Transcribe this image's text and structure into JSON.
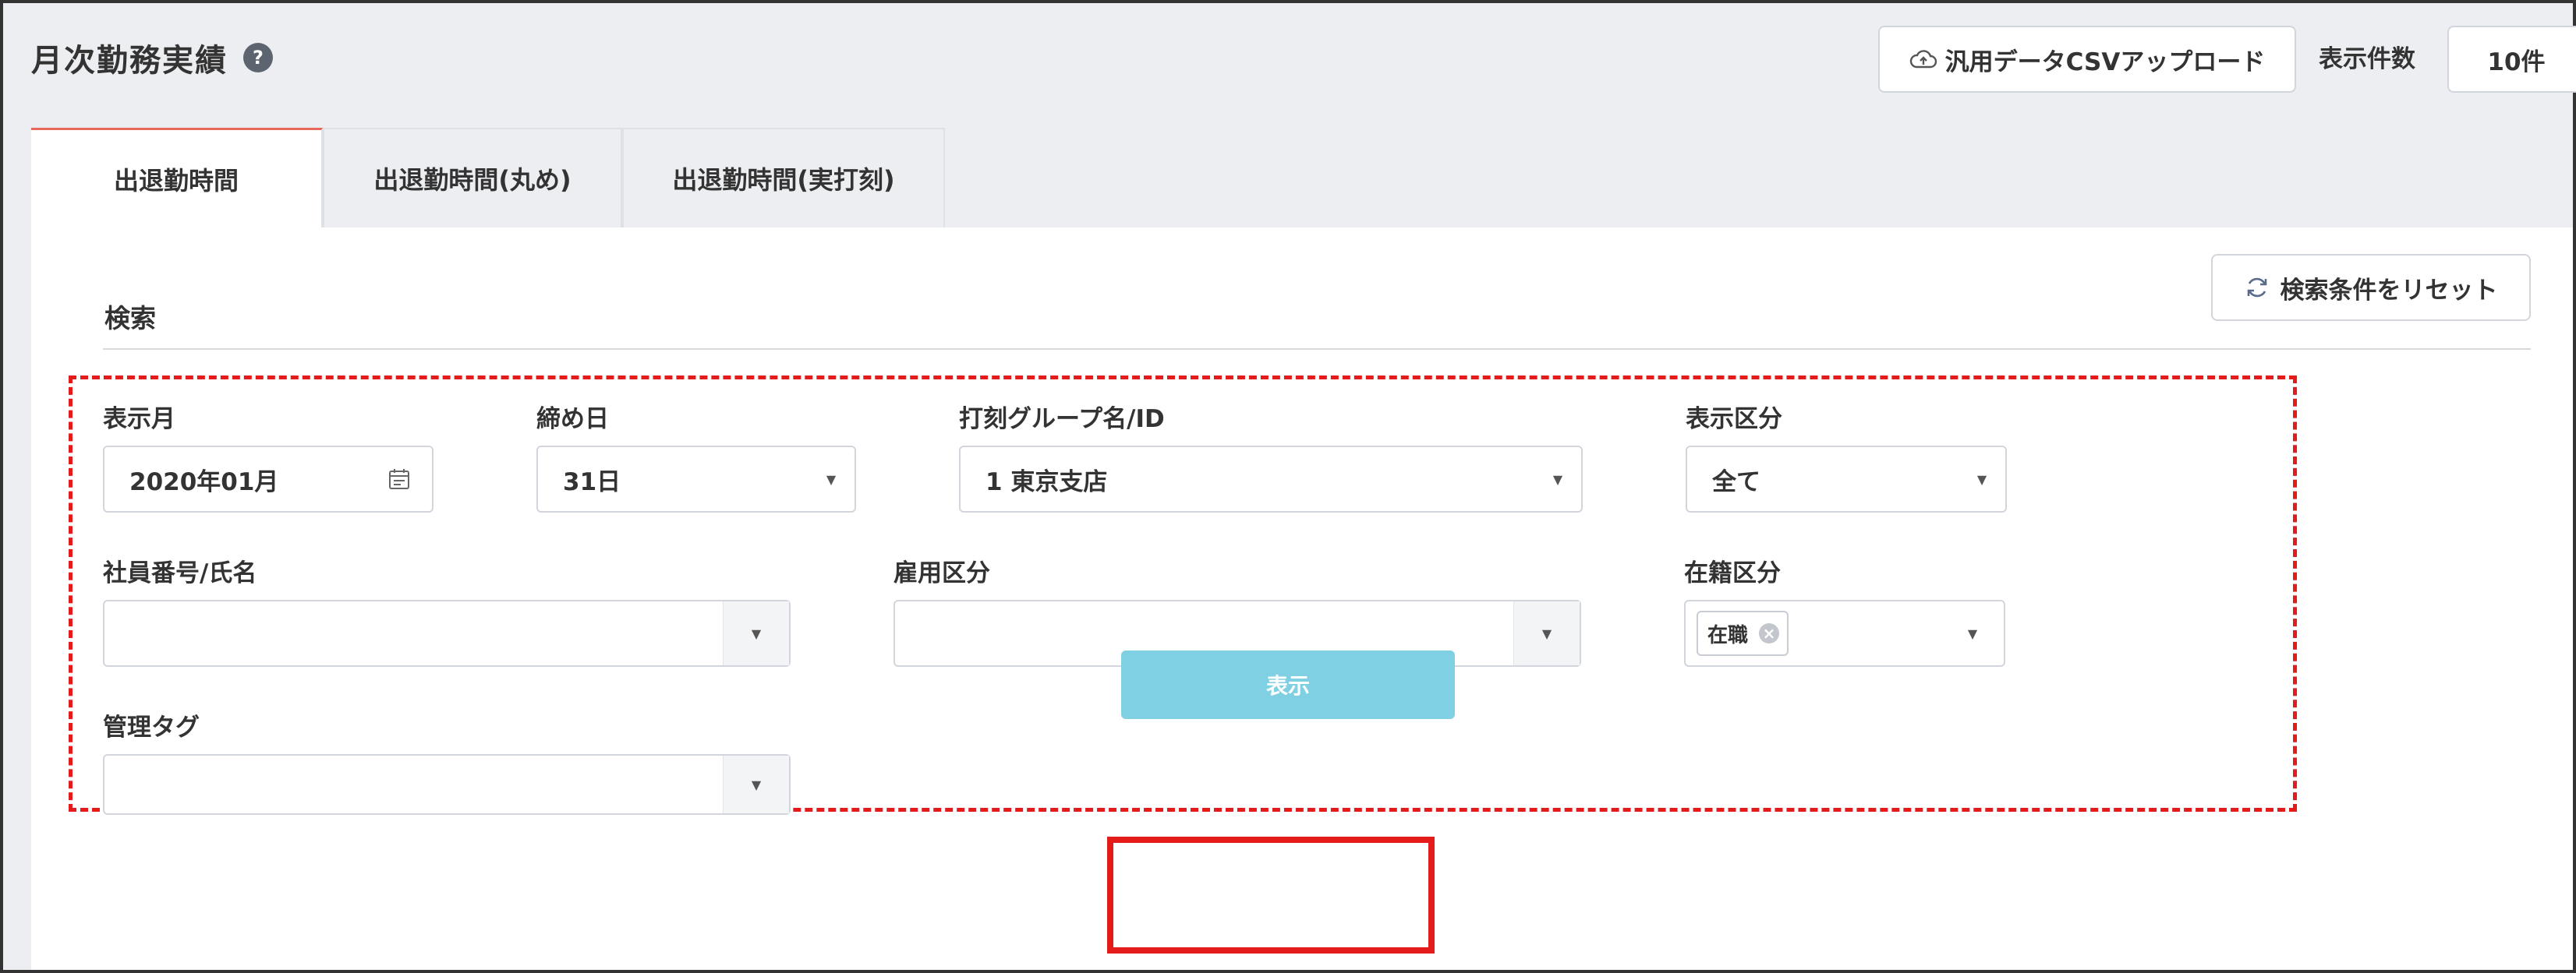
{
  "header": {
    "title": "月次勤務実績",
    "help_icon": "question-circle-icon",
    "csv_upload_label": "汎用データCSVアップロード",
    "csv_upload_icon": "cloud-upload-icon",
    "count_label": "表示件数",
    "count_value": "10件"
  },
  "tabs": [
    {
      "label": "出退勤時間",
      "active": true
    },
    {
      "label": "出退勤時間(丸め)",
      "active": false
    },
    {
      "label": "出退勤時間(実打刻)",
      "active": false
    }
  ],
  "search": {
    "section_label": "検索",
    "reset_label": "検索条件をリセット",
    "reset_icon": "refresh-icon",
    "fields": {
      "display_month": {
        "label": "表示月",
        "value": "2020年01月",
        "icon": "calendar-icon"
      },
      "closing_day": {
        "label": "締め日",
        "value": "31日"
      },
      "stamp_group": {
        "label": "打刻グループ名/ID",
        "value": "1 東京支店"
      },
      "display_type": {
        "label": "表示区分",
        "value": "全て"
      },
      "employee": {
        "label": "社員番号/氏名",
        "value": ""
      },
      "employment_type": {
        "label": "雇用区分",
        "value": ""
      },
      "enrollment": {
        "label": "在籍区分",
        "chip": "在職"
      },
      "management_tag": {
        "label": "管理タグ",
        "value": ""
      }
    },
    "submit_label": "表示"
  },
  "colors": {
    "accent_tab": "#e8685b",
    "submit_button": "#7fd0e3",
    "highlight_red": "#e41b1b"
  }
}
